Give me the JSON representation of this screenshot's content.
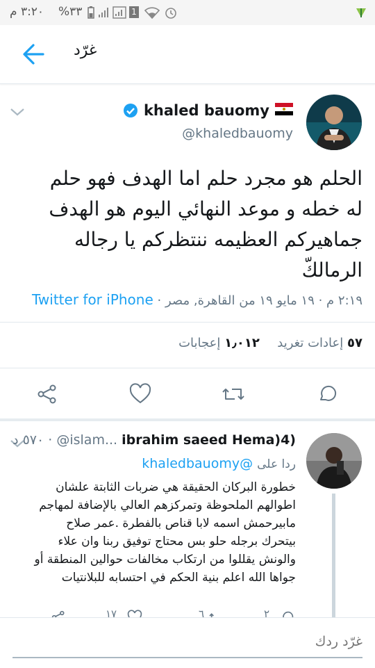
{
  "status_bar": {
    "time": "٣:٢٠ م",
    "battery": "%٣٣",
    "sim_badge": "1"
  },
  "app_bar": {
    "title": "غرّد"
  },
  "tweet": {
    "author_name": "khaled bauomy",
    "flag": "🇪🇬",
    "handle": "@khaledbauomy",
    "text_lines": [
      "الحلم هو مجرد حلم اما الهدف فهو حلم",
      "له خطه و موعد النهائي اليوم هو الهدف",
      "جماهيركم العظيمه ننتظركم يا رجاله",
      "الرمالكّ"
    ],
    "meta_source": "Twitter for iPhone",
    "meta_datetime": "٢:١٩ م · ١٩ مايو ١٩ من القاهرة, مصر ·",
    "retweets_count": "٥٧",
    "retweets_label": "إعادات تغريد",
    "likes_count": "١٫٠١٢",
    "likes_label": "إعجابات"
  },
  "reply": {
    "author_name": "ibrahim saeed Hema)4)",
    "handle": "@islam...",
    "time": "٥٧٠ د ·",
    "replying_to_label": "ردا على",
    "replying_to_handle": "@khaledbauomy",
    "text_lines": [
      "خطورة البركان الحقيقة هي ضربات الثابتة علشان",
      "اطوالهم الملحوظة وتمركزهم العالي بالإضافة لمهاجم",
      "مابيرحمش اسمه لابا قناص بالفطرة .عمر صلاح",
      "بيتحرك برجله حلو بس محتاج توفيق ربنا وان علاء",
      "والونش يقللوا من ارتكاب مخالفات حوالين المنطقة أو",
      "جواها الله اعلم بنية الحكم في احتسابه للبلانتيات"
    ],
    "reply_count": "٢",
    "retweet_count": "٦",
    "like_count": "١٧"
  },
  "composer": {
    "placeholder": "غرّد ردك"
  },
  "colors": {
    "accent": "#1da1f2",
    "secondary_text": "#657786",
    "divider": "#e1e8ed"
  }
}
